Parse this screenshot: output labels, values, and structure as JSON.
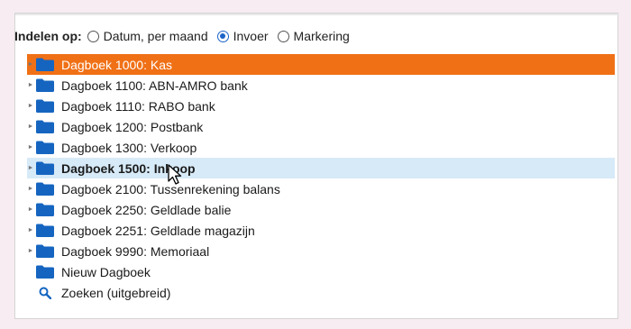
{
  "groupbar": {
    "label": "Indelen op:",
    "options": [
      "Datum, per maand",
      "Invoer",
      "Markering"
    ],
    "selected": "Invoer"
  },
  "tree": {
    "items": [
      {
        "label": "Dagboek 1000: Kas",
        "state": "selected"
      },
      {
        "label": "Dagboek 1100: ABN-AMRO bank",
        "state": "normal"
      },
      {
        "label": "Dagboek 1110: RABO bank",
        "state": "normal"
      },
      {
        "label": "Dagboek 1200: Postbank",
        "state": "normal"
      },
      {
        "label": "Dagboek 1300: Verkoop",
        "state": "normal"
      },
      {
        "label": "Dagboek 1500: Inkoop",
        "state": "hover"
      },
      {
        "label": "Dagboek 2100: Tussenrekening balans",
        "state": "normal"
      },
      {
        "label": "Dagboek 2250: Geldlade balie",
        "state": "normal"
      },
      {
        "label": "Dagboek 2251: Geldlade magazijn",
        "state": "normal"
      },
      {
        "label": "Dagboek 9990: Memoriaal",
        "state": "normal"
      }
    ],
    "new_label": "Nieuw Dagboek",
    "search_label": "Zoeken (uitgebreid)"
  },
  "colors": {
    "selected_bg": "#f07016",
    "hover_bg": "#d7eaf8",
    "folder": "#1565c0",
    "radio_accent": "#1e64c8"
  },
  "icons": {
    "folder": "folder-icon",
    "search": "search-icon",
    "expand": "chevron-right-icon"
  }
}
